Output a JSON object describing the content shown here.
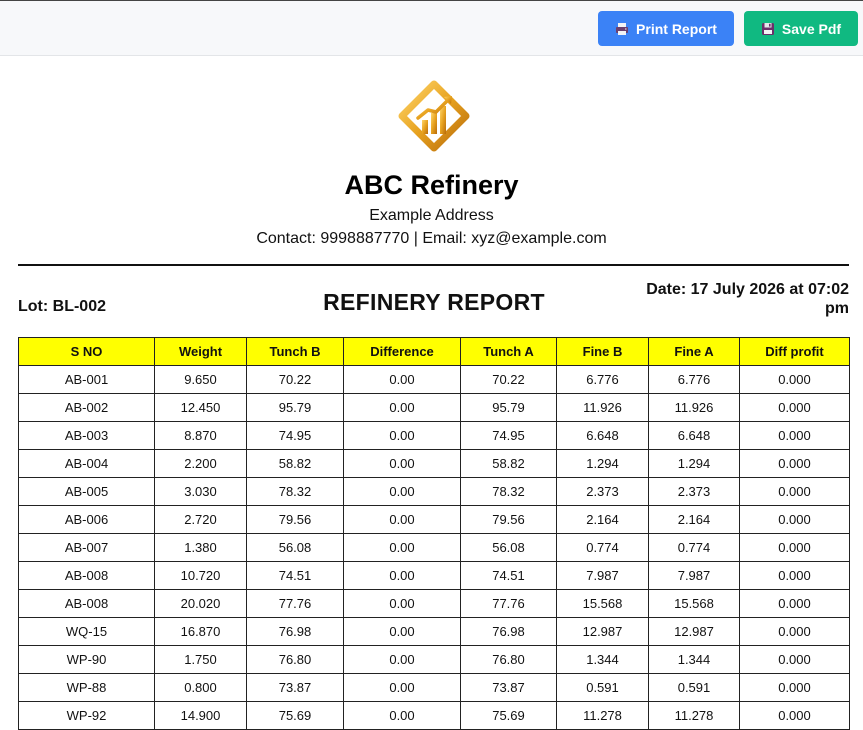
{
  "toolbar": {
    "print_label": "Print Report",
    "save_label": "Save Pdf",
    "print_color": "#3b82f6",
    "save_color": "#10b981"
  },
  "header": {
    "company_name": "ABC Refinery",
    "address": "Example Address",
    "contact": "Contact: 9998887770 | Email: xyz@example.com",
    "logo_icon": "gold-chart-logo-icon"
  },
  "report": {
    "lot": "Lot: BL-002",
    "title": "REFINERY REPORT",
    "date": "Date: 17 July 2026 at 07:02 pm"
  },
  "table": {
    "header_color": "#ffff00",
    "columns": [
      "S NO",
      "Weight",
      "Tunch B",
      "Difference",
      "Tunch A",
      "Fine B",
      "Fine A",
      "Diff profit"
    ],
    "rows": [
      [
        "AB-001",
        "9.650",
        "70.22",
        "0.00",
        "70.22",
        "6.776",
        "6.776",
        "0.000"
      ],
      [
        "AB-002",
        "12.450",
        "95.79",
        "0.00",
        "95.79",
        "11.926",
        "11.926",
        "0.000"
      ],
      [
        "AB-003",
        "8.870",
        "74.95",
        "0.00",
        "74.95",
        "6.648",
        "6.648",
        "0.000"
      ],
      [
        "AB-004",
        "2.200",
        "58.82",
        "0.00",
        "58.82",
        "1.294",
        "1.294",
        "0.000"
      ],
      [
        "AB-005",
        "3.030",
        "78.32",
        "0.00",
        "78.32",
        "2.373",
        "2.373",
        "0.000"
      ],
      [
        "AB-006",
        "2.720",
        "79.56",
        "0.00",
        "79.56",
        "2.164",
        "2.164",
        "0.000"
      ],
      [
        "AB-007",
        "1.380",
        "56.08",
        "0.00",
        "56.08",
        "0.774",
        "0.774",
        "0.000"
      ],
      [
        "AB-008",
        "10.720",
        "74.51",
        "0.00",
        "74.51",
        "7.987",
        "7.987",
        "0.000"
      ],
      [
        "AB-008",
        "20.020",
        "77.76",
        "0.00",
        "77.76",
        "15.568",
        "15.568",
        "0.000"
      ],
      [
        "WQ-15",
        "16.870",
        "76.98",
        "0.00",
        "76.98",
        "12.987",
        "12.987",
        "0.000"
      ],
      [
        "WP-90",
        "1.750",
        "76.80",
        "0.00",
        "76.80",
        "1.344",
        "1.344",
        "0.000"
      ],
      [
        "WP-88",
        "0.800",
        "73.87",
        "0.00",
        "73.87",
        "0.591",
        "0.591",
        "0.000"
      ],
      [
        "WP-92",
        "14.900",
        "75.69",
        "0.00",
        "75.69",
        "11.278",
        "11.278",
        "0.000"
      ]
    ]
  }
}
